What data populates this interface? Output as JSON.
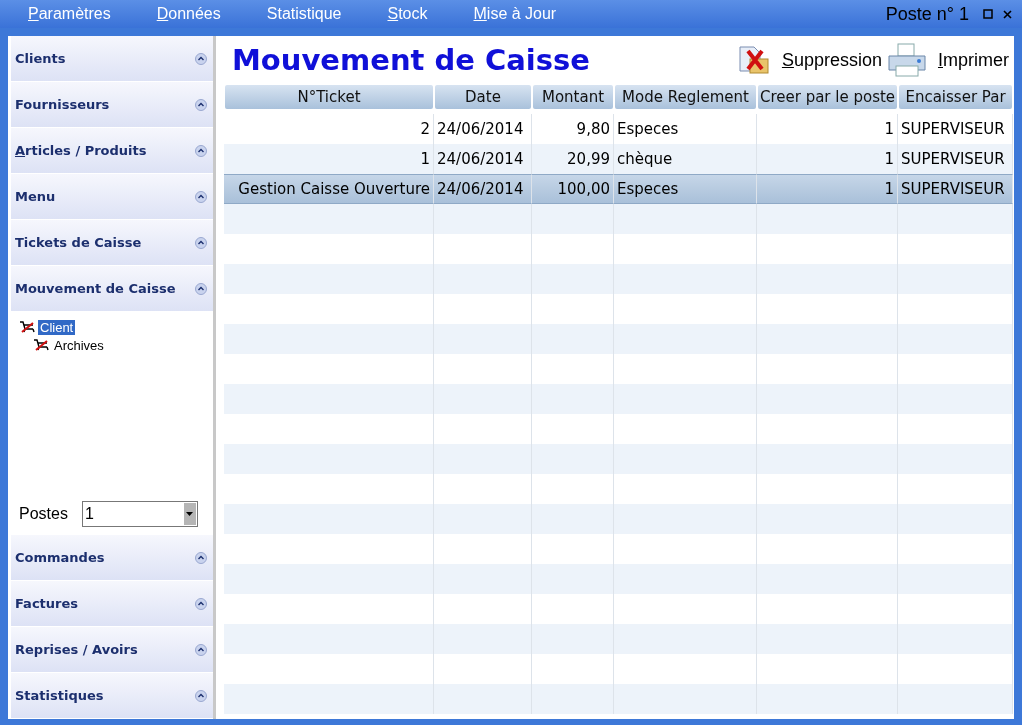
{
  "menu": [
    {
      "label": "Paramètres",
      "underline_first": true
    },
    {
      "label": "Données",
      "underline_first": true
    },
    {
      "label": "Statistique",
      "underline_first": false
    },
    {
      "label": "Stock",
      "underline_first": true
    },
    {
      "label": "Mise à Jour",
      "underline_first": true
    }
  ],
  "poste": "Poste n° 1",
  "sidebar": {
    "top_sections": [
      {
        "label": "Clients",
        "underline_first": false
      },
      {
        "label": "Fournisseurs",
        "underline_first": false
      },
      {
        "label": "Articles / Produits",
        "underline_first": true
      },
      {
        "label": "Menu",
        "underline_first": false
      },
      {
        "label": "Tickets de Caisse",
        "underline_first": false
      },
      {
        "label": "Mouvement de Caisse",
        "underline_first": false
      }
    ],
    "tree": [
      {
        "label": "Client",
        "selected": true,
        "children": [
          {
            "label": "Archives",
            "selected": false
          }
        ]
      }
    ],
    "postes": {
      "label": "Postes",
      "value": "1"
    },
    "bottom_sections": [
      {
        "label": "Commandes",
        "underline_first": false
      },
      {
        "label": "Factures",
        "underline_first": false
      },
      {
        "label": "Reprises / Avoirs",
        "underline_first": false
      },
      {
        "label": "Statistiques",
        "underline_first": false
      }
    ]
  },
  "title": "Mouvement de Caisse",
  "actions": [
    {
      "kind": "delete",
      "label": "Suppression",
      "underline_first": true
    },
    {
      "kind": "print",
      "label": "Imprimer",
      "underline_first": true
    }
  ],
  "table": {
    "columns": [
      {
        "label": "N°Ticket"
      },
      {
        "label": "Date"
      },
      {
        "label": "Montant"
      },
      {
        "label": "Mode Reglement"
      },
      {
        "label": "Creer par le poste"
      },
      {
        "label": "Encaisser Par"
      }
    ],
    "rows": [
      {
        "selected": false,
        "cells": [
          "2",
          "24/06/2014",
          "9,80",
          "Especes",
          "1",
          "SUPERVISEUR"
        ]
      },
      {
        "selected": false,
        "cells": [
          "1",
          "24/06/2014",
          "20,99",
          "chèque",
          "1",
          "SUPERVISEUR"
        ]
      },
      {
        "selected": true,
        "cells": [
          "Gestion Caisse Ouverture",
          "24/06/2014",
          "100,00",
          "Especes",
          "1",
          "SUPERVISEUR"
        ]
      }
    ]
  }
}
